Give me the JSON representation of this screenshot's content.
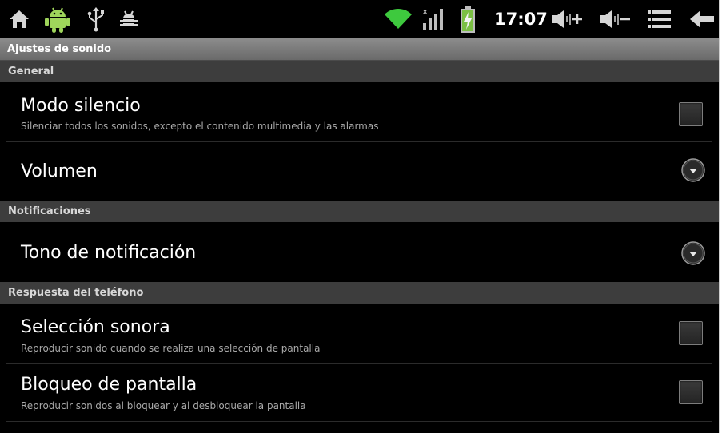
{
  "status_bar": {
    "time": "17:07",
    "icons": [
      "home-icon",
      "android-icon",
      "usb-icon",
      "debug-bug-icon",
      "wifi-icon",
      "signal-icon",
      "battery-charging-icon",
      "volume-up-icon",
      "volume-down-icon",
      "menu-icon",
      "back-icon"
    ],
    "wifi_color": "#3ec93e",
    "battery_color": "#7bc043"
  },
  "title_bar": {
    "title": "Ajustes de sonido"
  },
  "sections": {
    "general": {
      "header": "General",
      "silent_mode": {
        "title": "Modo silencio",
        "summary": "Silenciar todos los sonidos, excepto el contenido multimedia y las alarmas",
        "checked": false
      },
      "volume": {
        "title": "Volumen"
      }
    },
    "notifications": {
      "header": "Notificaciones",
      "notification_tone": {
        "title": "Tono de notificación"
      }
    },
    "phone_response": {
      "header": "Respuesta del teléfono",
      "audible_selection": {
        "title": "Selección sonora",
        "summary": "Reproducir sonido cuando se realiza una selección de pantalla",
        "checked": false
      },
      "screen_lock": {
        "title": "Bloqueo de pantalla",
        "summary": "Reproducir sonidos al bloquear y al desbloquear la pantalla",
        "checked": false
      }
    }
  }
}
